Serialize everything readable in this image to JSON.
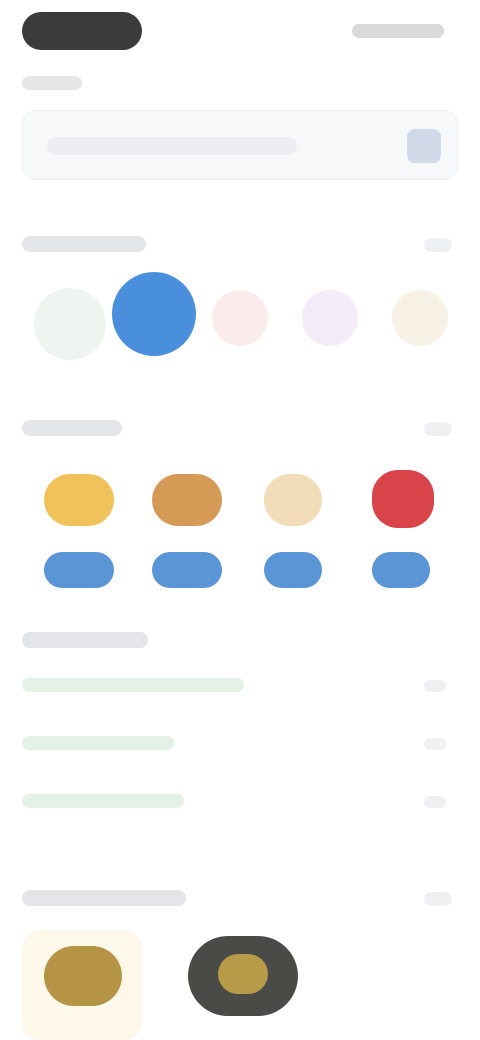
{
  "header": {
    "pill_label": ""
  },
  "search": {
    "placeholder": ""
  },
  "categories": {
    "title": ""
  },
  "trending": {
    "title": "",
    "items": [
      {
        "button_label": ""
      },
      {
        "button_label": ""
      },
      {
        "button_label": ""
      },
      {
        "button_label": ""
      }
    ]
  },
  "list_section": {
    "title": "",
    "rows": [
      {
        "label": "",
        "count": ""
      },
      {
        "label": "",
        "count": ""
      },
      {
        "label": "",
        "count": ""
      }
    ]
  },
  "bottom_section": {
    "title": ""
  },
  "colors": {
    "accent_blue": "#4a8fdc",
    "button_blue": "#5a96d6",
    "dark_pill": "#3b3b3b"
  }
}
